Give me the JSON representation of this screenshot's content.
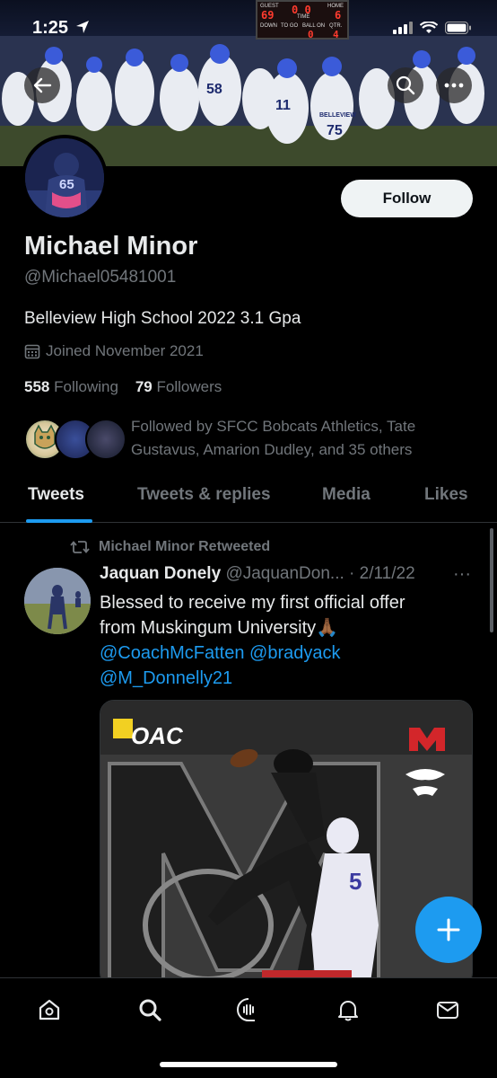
{
  "status": {
    "time": "1:25"
  },
  "scoreboard": {
    "guest_label": "GUEST",
    "home_label": "HOME",
    "time_label": "TIME",
    "down_label": "DOWN",
    "togo_label": "TO GO",
    "ball_label": "BALL ON",
    "qtr_label": "QTR.",
    "guest_score": "69",
    "home_score": "6",
    "clock": "0 0",
    "down": "0",
    "qtr": "4"
  },
  "banner_jerseys": {
    "j1": "58",
    "j2": "11",
    "j3": "75",
    "j4": "65",
    "belleview": "BELLEVIEW"
  },
  "header": {
    "back_icon": "back-arrow-icon",
    "search_icon": "search-icon",
    "more_icon": "more-icon"
  },
  "profile": {
    "avatar_jersey": "65",
    "follow_label": "Follow",
    "name": "Michael Minor",
    "handle": "@Michael05481001",
    "bio": "Belleview High School 2022 3.1 Gpa",
    "joined": "Joined November 2021",
    "following_count": "558",
    "following_label": "Following",
    "followers_count": "79",
    "followers_label": "Followers",
    "followed_by_line1": "Followed by SFCC Bobcats Athletics, Tate",
    "followed_by_line2": "Gustavus, Amarion Dudley, and 35 others"
  },
  "tabs": [
    {
      "label": "Tweets",
      "active": true
    },
    {
      "label": "Tweets & replies",
      "active": false
    },
    {
      "label": "Media",
      "active": false
    },
    {
      "label": "Likes",
      "active": false
    }
  ],
  "tweet": {
    "retweet_label": "Michael Minor Retweeted",
    "author_name": "Jaquan Donely",
    "author_handle": "@JaquanDon...",
    "date": "· 2/11/22",
    "more": "···",
    "text_line1": "Blessed to receive my first official offer",
    "text_line2": "from Muskingum University🙏🏾",
    "mention1": "@CoachMcFatten",
    "mention2": "@bradyack",
    "mention3": "@M_Donnelly21",
    "media_logo": "OAC",
    "media_jersey": "5"
  },
  "colors": {
    "accent": "#1d9bf0",
    "muted": "#71767b",
    "text": "#e7e9ea",
    "background": "#000000"
  },
  "bottom_nav": [
    "home-icon",
    "search-icon",
    "spaces-icon",
    "notifications-icon",
    "messages-icon"
  ],
  "fab_icon": "compose-plus-icon"
}
